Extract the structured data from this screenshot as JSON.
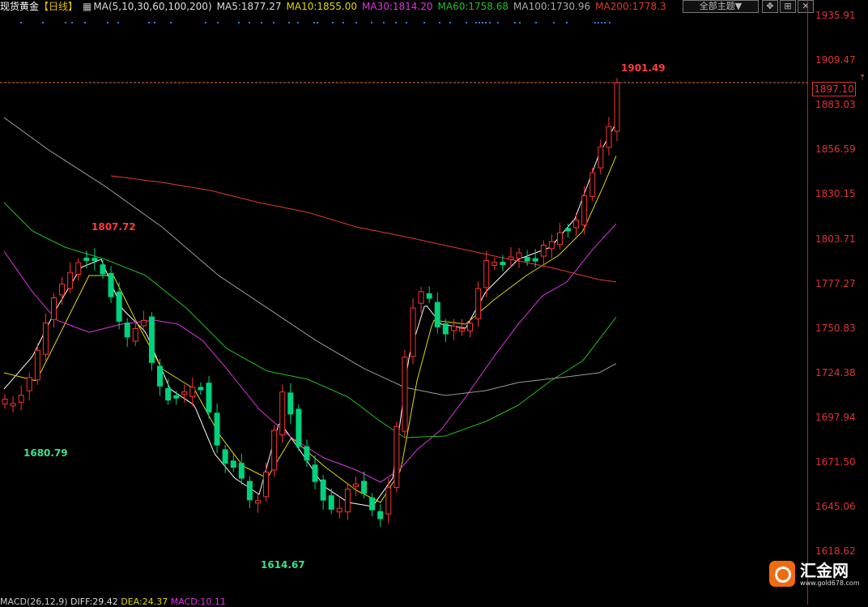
{
  "header": {
    "symbol": "现货黄金",
    "period": "【日线】",
    "ma_def": "MA(5,10,30,60,100,200)",
    "ma5": "MA5:1877.27",
    "ma10": "MA10:1855.00",
    "ma30": "MA30:1814.20",
    "ma60": "MA60:1758.68",
    "ma100": "MA100:1730.96",
    "ma200": "MA200:1778.3"
  },
  "toolbar": {
    "theme_label": "全部主题▼"
  },
  "price_axis": {
    "ticks": [
      "1935.91",
      "1909.47",
      "1883.03",
      "1856.59",
      "1830.15",
      "1803.71",
      "1777.27",
      "1750.83",
      "1724.38",
      "1697.94",
      "1671.50",
      "1645.06",
      "1618.62"
    ],
    "current": "1897.10"
  },
  "annotations": {
    "high_recent": "1901.49",
    "high_left": "1807.72",
    "low_left": "1680.79",
    "low_mid": "1614.67"
  },
  "logo": {
    "name": "汇金网",
    "url": "www.gold678.com"
  },
  "bottom": {
    "macd": "MACD(26,12,9)",
    "diff": "DIFF:29.42",
    "dea": "DEA:24.37",
    "macd_val": "MACD:10.11"
  },
  "colors": {
    "up": "#ff3232",
    "down": "#00d27e",
    "ma5": "#ffffff",
    "ma10": "#e3d900",
    "ma30": "#e033e0",
    "ma60": "#22c022",
    "ma100": "#9a9a9a",
    "ma200": "#e03c2a"
  }
}
